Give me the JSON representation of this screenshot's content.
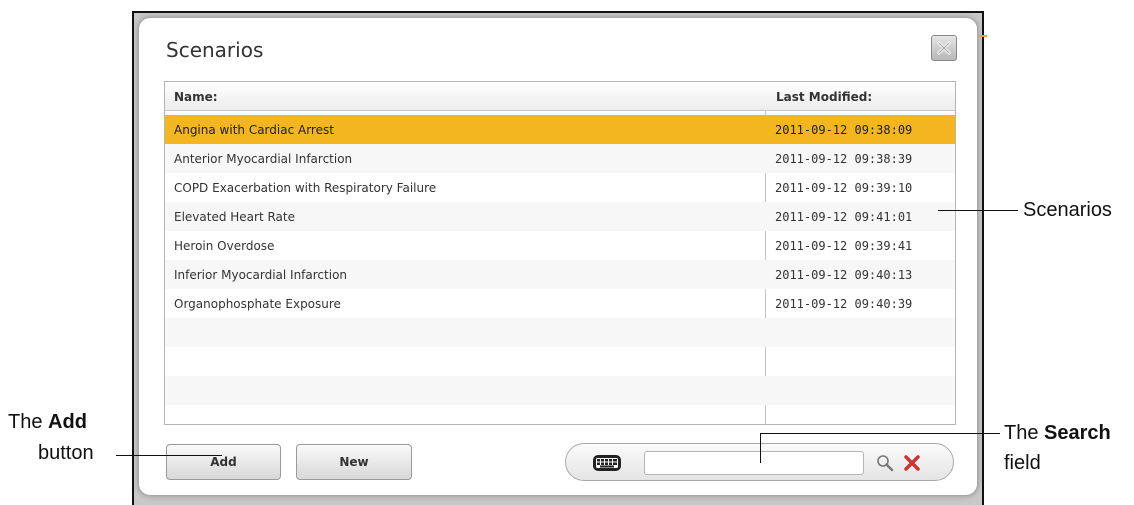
{
  "dialog": {
    "title": "Scenarios",
    "close_label": "×"
  },
  "table": {
    "columns": [
      "Name:",
      "Last Modified:"
    ],
    "rows": [
      {
        "name": "Angina with Cardiac Arrest",
        "modified": "2011-09-12 09:38:09",
        "selected": true
      },
      {
        "name": "Anterior Myocardial Infarction",
        "modified": "2011-09-12 09:38:39",
        "selected": false
      },
      {
        "name": "COPD Exacerbation with Respiratory Failure",
        "modified": "2011-09-12 09:39:10",
        "selected": false
      },
      {
        "name": "Elevated Heart Rate",
        "modified": "2011-09-12 09:41:01",
        "selected": false
      },
      {
        "name": "Heroin Overdose",
        "modified": "2011-09-12 09:39:41",
        "selected": false
      },
      {
        "name": "Inferior Myocardial Infarction",
        "modified": "2011-09-12 09:40:13",
        "selected": false
      },
      {
        "name": "Organophosphate Exposure",
        "modified": "2011-09-12 09:40:39",
        "selected": false
      }
    ]
  },
  "buttons": {
    "add_label": "Add",
    "new_label": "New"
  },
  "search": {
    "value": "",
    "placeholder": "",
    "keyboard_icon": "keyboard-icon",
    "search_icon": "magnifier-icon",
    "clear_icon": "clear-x-icon"
  },
  "callouts": {
    "scenarios": "Scenarios",
    "add_prefix": "The ",
    "add_bold": "Add",
    "add_suffix": "button",
    "search_prefix": "The ",
    "search_bold": "Search",
    "search_suffix": "field"
  },
  "colors": {
    "selected_row": "#f3b520",
    "clear_icon": "#cc3333"
  }
}
